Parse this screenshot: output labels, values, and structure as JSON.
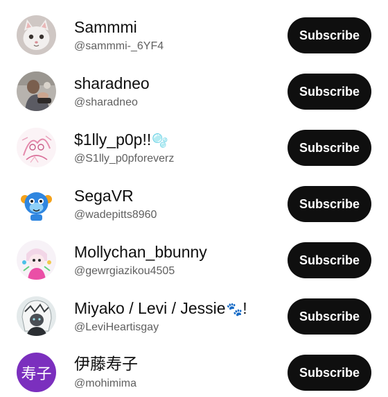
{
  "subscribe_label": "Subscribe",
  "colors": {
    "button_bg": "#0f0f0f",
    "button_text": "#ffffff",
    "name_text": "#0f0f0f",
    "handle_text": "#606060"
  },
  "channels": [
    {
      "name": "Sammmi",
      "handle": "@sammmi-_6YF4",
      "avatar_icon": "cat-photo-avatar"
    },
    {
      "name": "sharadneo",
      "handle": "@sharadneo",
      "avatar_icon": "person-photo-avatar"
    },
    {
      "name": "$1lly_p0p!!",
      "name_glyph": "🫧",
      "handle": "@S1lly_p0pforeverz",
      "avatar_icon": "pink-sketch-avatar"
    },
    {
      "name": "SegaVR",
      "handle": "@wadepitts8960",
      "avatar_icon": "blue-cartoon-avatar"
    },
    {
      "name": "Mollychan_bbunny",
      "handle": "@gewrgiazikou4505",
      "avatar_icon": "pink-character-avatar"
    },
    {
      "name": "Miyako / Levi / Jessie",
      "name_glyph": "🐾",
      "name_suffix": "!",
      "handle": "@LeviHeartisgay",
      "avatar_icon": "anime-character-avatar"
    },
    {
      "name": "伊藤寿子",
      "handle": "@mohimima",
      "avatar_text": "寿子",
      "avatar_color": "#7b2fbe"
    }
  ]
}
